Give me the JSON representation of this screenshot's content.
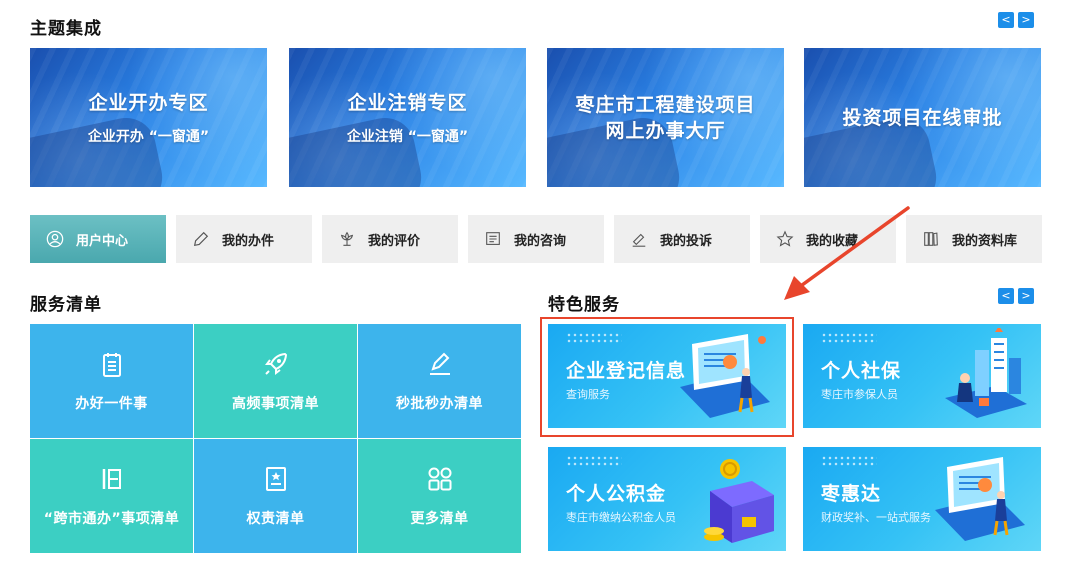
{
  "theme_section": {
    "title": "主题集成",
    "prev_icon": "<",
    "next_icon": ">",
    "banners": [
      {
        "title": "企业开办专区",
        "subtitle": "企业开办 “一窗通”"
      },
      {
        "title": "企业注销专区",
        "subtitle": "企业注销 “一窗通”"
      },
      {
        "title": "枣庄市工程建设项目\n网上办事大厅",
        "subtitle": ""
      },
      {
        "title": "投资项目在线审批",
        "subtitle": ""
      }
    ]
  },
  "tabs": [
    {
      "label": "用户中心",
      "icon": "user-icon",
      "active": true
    },
    {
      "label": "我的办件",
      "icon": "pencil-icon",
      "active": false
    },
    {
      "label": "我的评价",
      "icon": "flower-icon",
      "active": false
    },
    {
      "label": "我的咨询",
      "icon": "message-icon",
      "active": false
    },
    {
      "label": "我的投诉",
      "icon": "complaint-icon",
      "active": false
    },
    {
      "label": "我的收藏",
      "icon": "star-icon",
      "active": false
    },
    {
      "label": "我的资料库",
      "icon": "library-icon",
      "active": false
    }
  ],
  "service_section": {
    "title": "服务清单",
    "tiles": [
      {
        "label": "办好一件事",
        "icon": "clipboard-icon",
        "color": "#3db4ec"
      },
      {
        "label": "高频事项清单",
        "icon": "rocket-icon",
        "color": "#3ccfc3"
      },
      {
        "label": "秒批秒办清单",
        "icon": "edit-icon",
        "color": "#3db4ec"
      },
      {
        "label": "“跨市通办”事项清单",
        "icon": "list-icon",
        "color": "#3ccfc3"
      },
      {
        "label": "权责清单",
        "icon": "certificate-icon",
        "color": "#3db4ec"
      },
      {
        "label": "更多清单",
        "icon": "grid-icon",
        "color": "#3ccfc3"
      }
    ]
  },
  "feature_section": {
    "title": "特色服务",
    "prev_icon": "<",
    "next_icon": ">",
    "cards": [
      {
        "title": "企业登记信息",
        "subtitle": "查询服务",
        "art": "laptop-person-icon"
      },
      {
        "title": "个人社保",
        "subtitle": "枣庄市参保人员",
        "art": "building-person-icon"
      },
      {
        "title": "个人公积金",
        "subtitle": "枣庄市缴纳公积金人员",
        "art": "coin-box-icon"
      },
      {
        "title": "枣惠达",
        "subtitle": "财政奖补、一站式服务",
        "art": "laptop-person-icon"
      }
    ]
  },
  "colors": {
    "accent": "#1c8ee9",
    "active_tab": "#4aa8ae",
    "tile_blue": "#3db4ec",
    "tile_teal": "#3ccfc3",
    "highlight": "#e8452c"
  }
}
